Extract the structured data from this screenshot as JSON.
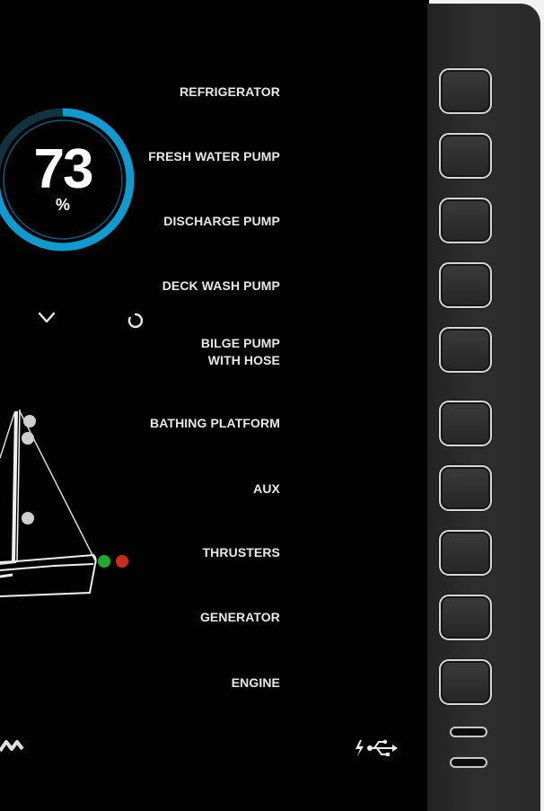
{
  "gauge": {
    "value": "73",
    "unit": "%",
    "level_fraction": 0.73,
    "ring_color": "#0f9ad0"
  },
  "controls": {
    "collapse_icon": "chevron-down-icon",
    "refresh_icon": "refresh-icon"
  },
  "status_lights": {
    "starboard_color": "#22a82a",
    "port_color": "#cc2a1a"
  },
  "switches": [
    {
      "label": "REFRIGERATOR"
    },
    {
      "label": "FRESH WATER PUMP"
    },
    {
      "label": "DISCHARGE PUMP"
    },
    {
      "label": "DECK WASH PUMP"
    },
    {
      "label": "BILGE PUMP\nWITH HOSE"
    },
    {
      "label": "BATHING PLATFORM"
    },
    {
      "label": "AUX"
    },
    {
      "label": "THRUSTERS"
    },
    {
      "label": "GENERATOR"
    },
    {
      "label": "ENGINE"
    }
  ],
  "footer": {
    "left_icon": "wave-icon",
    "right_icon": "charging-usb-icon"
  }
}
